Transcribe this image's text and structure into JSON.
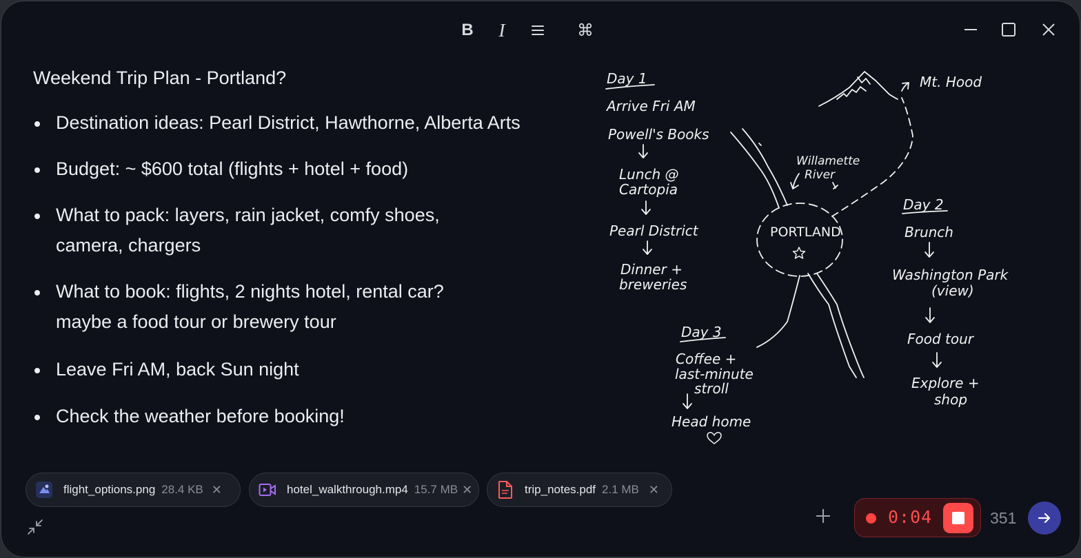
{
  "toolbar": {
    "bold_label": "B",
    "italic_label": "I",
    "list_label": "☰",
    "command_label": "⌘"
  },
  "window_controls": [
    "minimize",
    "maximize",
    "close"
  ],
  "note": {
    "title": "Weekend Trip Plan - Portland?",
    "bullets": [
      "Destination ideas: Pearl District, Hawthorne, Alberta Arts",
      "Budget: ~ $600 total (flights + hotel + food)",
      "What to pack: layers, rain jacket, comfy shoes,",
      "camera, chargers",
      "What to book: flights, 2 nights hotel, rental car?",
      "maybe a food tour or brewery tour",
      "Leave Fri AM, back Sun night",
      "Check the weather before booking!"
    ]
  },
  "sketch": {
    "day1": {
      "heading": "Day 1",
      "items": [
        "Arrive Fri AM",
        "Powell's Books",
        "Lunch @",
        "Cartopia",
        "Pearl District",
        "Dinner +",
        "breweries"
      ]
    },
    "day2": {
      "heading": "Day 2",
      "items": [
        "Brunch",
        "Washington Park",
        "(view)",
        "Food tour",
        "Explore +",
        "shop"
      ]
    },
    "day3": {
      "heading": "Day 3",
      "items": [
        "Coffee +",
        "last-minute",
        "stroll",
        "Head home"
      ]
    },
    "map": {
      "city": "PORTLAND",
      "river": [
        "Willamette",
        "River"
      ],
      "mountain": "Mt. Hood"
    }
  },
  "attachments": [
    {
      "name": "flight_options.png",
      "size": "28.4 KB",
      "icon": "image-file-icon"
    },
    {
      "name": "hotel_walkthrough.mp4",
      "size": "15.7 MB",
      "icon": "video-file-icon"
    },
    {
      "name": "trip_notes.pdf",
      "size": "2.1 MB",
      "icon": "pdf-file-icon"
    }
  ],
  "recorder": {
    "time": "0:04"
  },
  "char_count": "351",
  "colors": {
    "background": "#0e1119",
    "record_red": "#ff4a4a",
    "send_button": "#3a3ea0",
    "video_icon": "#a56cf0",
    "pdf_icon": "#ff5a5a"
  }
}
